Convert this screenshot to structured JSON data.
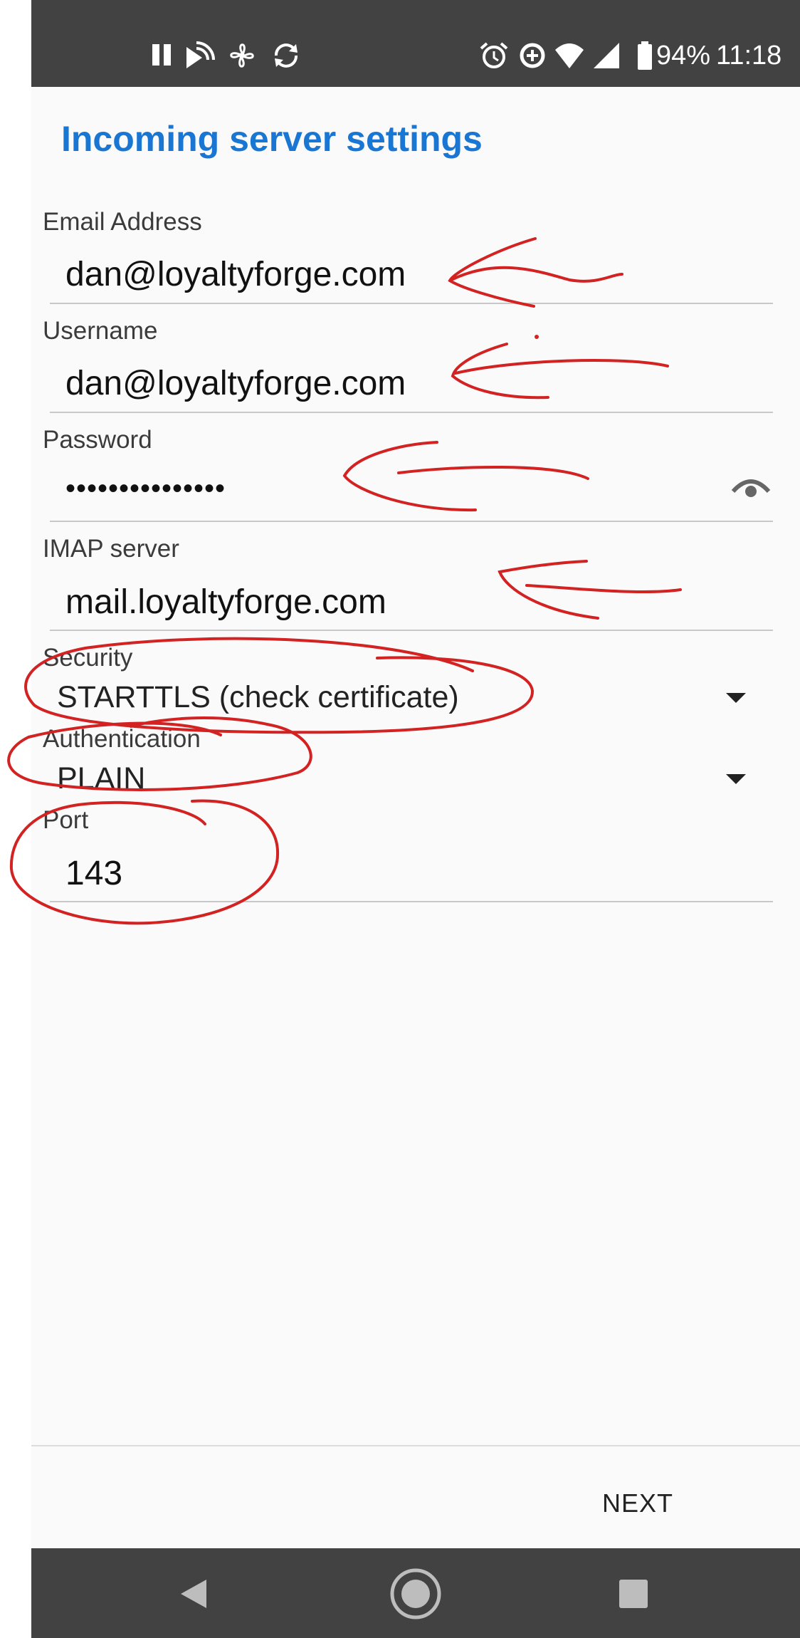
{
  "status_bar": {
    "icons": [
      "pause-icon",
      "cast-icon",
      "fan-icon",
      "sync-icon",
      "alarm-icon",
      "data-saver-icon",
      "wifi-icon",
      "signal-icon",
      "battery-icon"
    ],
    "battery": "94%",
    "time": "11:18"
  },
  "page": {
    "title": "Incoming server settings"
  },
  "fields": {
    "email": {
      "label": "Email Address",
      "value": "dan@loyaltyforge.com"
    },
    "username": {
      "label": "Username",
      "value": "dan@loyaltyforge.com"
    },
    "password": {
      "label": "Password",
      "value": "•••••••••••••••",
      "toggle_icon": "visibility-icon"
    },
    "imap_server": {
      "label": "IMAP server",
      "value": "mail.loyaltyforge.com"
    },
    "security": {
      "label": "Security",
      "value": "STARTTLS (check certificate)"
    },
    "authentication": {
      "label": "Authentication",
      "value": "PLAIN"
    },
    "port": {
      "label": "Port",
      "value": "143"
    }
  },
  "footer": {
    "next_label": "NEXT"
  },
  "nav_bar": {
    "icons": [
      "back-icon",
      "home-icon",
      "recents-icon"
    ]
  },
  "colors": {
    "accent": "#1976d2",
    "status_bar": "#424242",
    "annotation": "#d32222"
  }
}
